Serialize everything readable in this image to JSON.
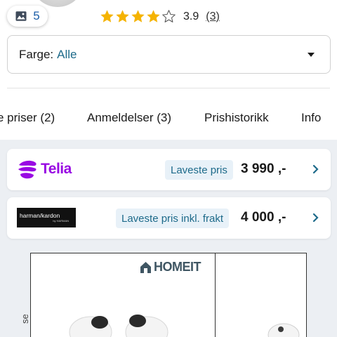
{
  "gallery": {
    "image_count": "5"
  },
  "rating": {
    "stars_filled": 4,
    "stars_total": 5,
    "value": "3.9",
    "count": "(3)",
    "star_color": "#f5b301"
  },
  "color_filter": {
    "label": "Farge:",
    "value": "Alle"
  },
  "tabs": [
    {
      "label": "e priser (2)"
    },
    {
      "label": "Anmeldelser (3)"
    },
    {
      "label": "Prishistorikk"
    },
    {
      "label": "Info"
    }
  ],
  "offers": [
    {
      "store": "Telia",
      "price_label": "Laveste pris",
      "price": "3 990 ,-",
      "brand_color": "#990ae3"
    },
    {
      "store_logo_text": "harman/kardon",
      "store_logo_sub": "by HARMAN",
      "price_label": "Laveste pris inkl. frakt",
      "price": "4 000 ,-"
    }
  ],
  "product_image": {
    "logo_text": "HOMEIT",
    "edge_text": "se"
  },
  "colors": {
    "accent": "#1d6a8a",
    "link_blue": "#1d5fa8",
    "offers_bg": "#eceff3"
  }
}
